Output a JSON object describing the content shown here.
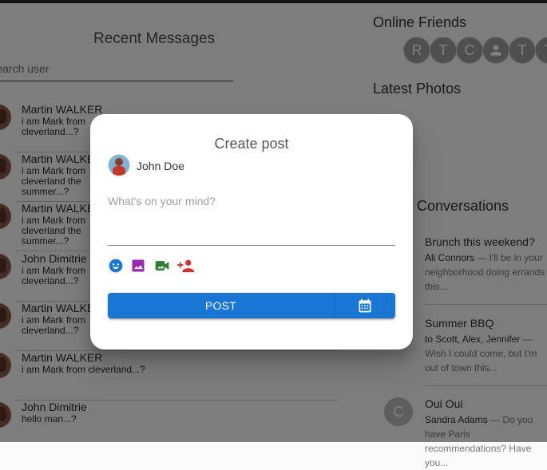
{
  "recent": {
    "title": "Recent Messages",
    "search_placeholder": "Search user",
    "messages": [
      {
        "name": "Martin WALKER",
        "text": "i am Mark from cleverland...?"
      },
      {
        "name": "Martin WALKER",
        "text": "i am Mark from cleverland the summer...?"
      },
      {
        "name": "Martin WALKER",
        "text": "i am Mark from cleverland the summer...?"
      },
      {
        "name": "John Dimitrie",
        "text": "i am Mark from cleverland...?"
      },
      {
        "name": "Martin WALKER",
        "text": "i am Mark from cleverland...?"
      },
      {
        "name": "Martin WALKER",
        "text": "i am Mark from cleverland...?"
      },
      {
        "name": "John Dimitrie",
        "text": "hello man...?"
      }
    ]
  },
  "online": {
    "title": "Online Friends",
    "friends": [
      "R",
      "T",
      "C",
      "",
      "T",
      "T"
    ]
  },
  "photos": {
    "title": "Latest Photos"
  },
  "conversations": {
    "title": "Conversations",
    "items": [
      {
        "title": "Brunch this weekend?",
        "who": "Ali Connors",
        "body": " — I'll be in your neighborhood doing errands this..."
      },
      {
        "title": "Summer BBQ",
        "who": "to Scott, Alex, Jennifer",
        "body": " — Wish I could come, but I'm out of town this..."
      },
      {
        "title": "Oui Oui",
        "who": "Sandra Adams",
        "body": " — Do you have Paris recommendations? Have you..."
      }
    ],
    "avatar_letter": "C"
  },
  "dialog": {
    "title": "Create post",
    "author": "John Doe",
    "placeholder": "What's on your mind?",
    "post_label": "POST",
    "icons": [
      "emoji-icon",
      "image-icon",
      "video-icon",
      "tag-person-icon"
    ],
    "icon_colors": {
      "emoji": "#1976d2",
      "image": "#9c27b0",
      "video": "#2e7d32",
      "tag": "#d32f2f"
    },
    "primary_color": "#1976d2"
  }
}
